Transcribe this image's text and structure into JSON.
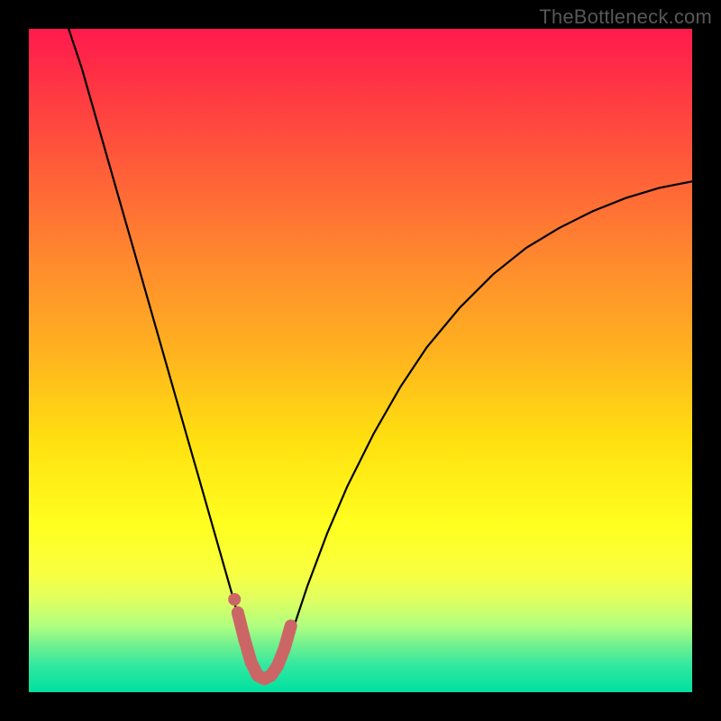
{
  "watermark": "TheBottleneck.com",
  "colors": {
    "frame_bg": "#000000",
    "curve": "#000000",
    "basin": "#cc6666",
    "gradient_top": "#ff1a4d",
    "gradient_mid": "#ffff20",
    "gradient_bottom": "#00e0a0"
  },
  "chart_data": {
    "type": "line",
    "title": "",
    "xlabel": "",
    "ylabel": "",
    "xlim": [
      0,
      100
    ],
    "ylim": [
      0,
      100
    ],
    "series": [
      {
        "name": "bottleneck-curve",
        "x": [
          6,
          8,
          10,
          12,
          14,
          16,
          18,
          20,
          22,
          24,
          26,
          28,
          30,
          32,
          33,
          34,
          35,
          36,
          37,
          38,
          40,
          42,
          45,
          48,
          52,
          56,
          60,
          65,
          70,
          75,
          80,
          85,
          90,
          95,
          100
        ],
        "y": [
          100,
          94,
          87,
          80,
          73,
          66,
          59,
          52,
          45,
          38,
          31,
          24,
          17,
          10,
          7,
          4,
          2,
          2,
          3,
          5,
          10,
          16,
          24,
          31,
          39,
          46,
          52,
          58,
          63,
          67,
          70,
          72.5,
          74.5,
          76,
          77
        ]
      }
    ],
    "annotations": {
      "basin_highlight": {
        "x": [
          31.5,
          32.5,
          33.5,
          34.5,
          35.5,
          36.5,
          37.5,
          38.5,
          39.5
        ],
        "y": [
          12,
          8,
          4.5,
          2.5,
          2,
          2.5,
          4,
          6.5,
          10
        ]
      },
      "basin_dot": {
        "x": 31,
        "y": 14
      }
    }
  }
}
